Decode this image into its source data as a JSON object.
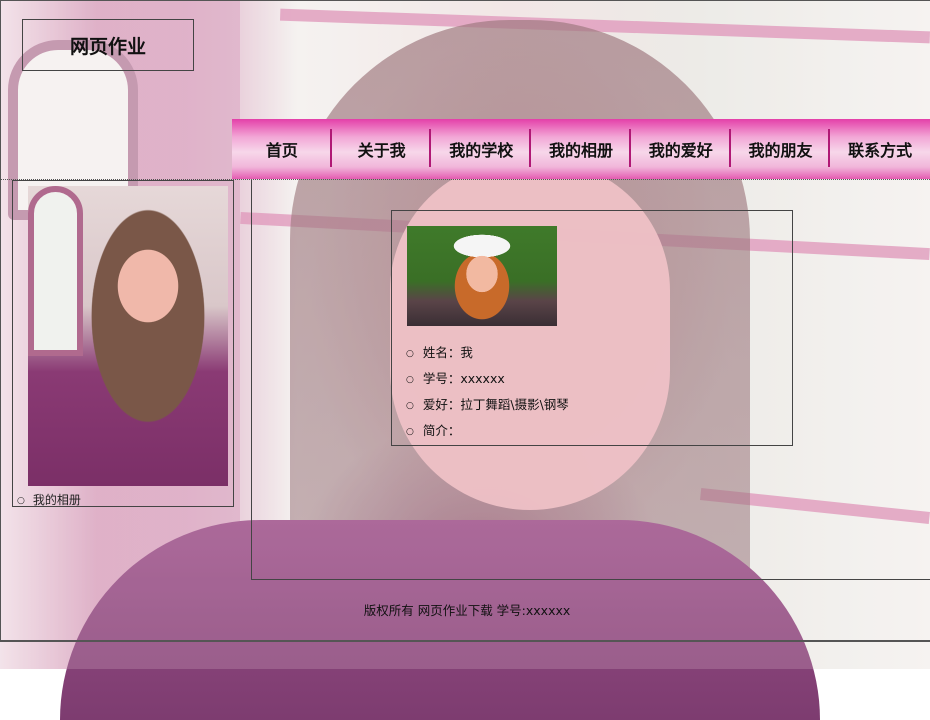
{
  "site": {
    "logo": "网页作业"
  },
  "nav": {
    "items": [
      {
        "label": "首页"
      },
      {
        "label": "关于我"
      },
      {
        "label": "我的学校"
      },
      {
        "label": "我的相册"
      },
      {
        "label": "我的爱好"
      },
      {
        "label": "我的朋友"
      },
      {
        "label": "联系方式"
      }
    ],
    "gradient_top": "#e43fa9",
    "separator_color": "#b01875"
  },
  "sidebar": {
    "link": "我的相册"
  },
  "profile": {
    "items": [
      "姓名：我",
      "学号：xxxxxx",
      "爱好：拉丁舞蹈\\摄影\\钢琴",
      "简介："
    ]
  },
  "footer": {
    "text": "版权所有 网页作业下载 学号:xxxxxx"
  }
}
